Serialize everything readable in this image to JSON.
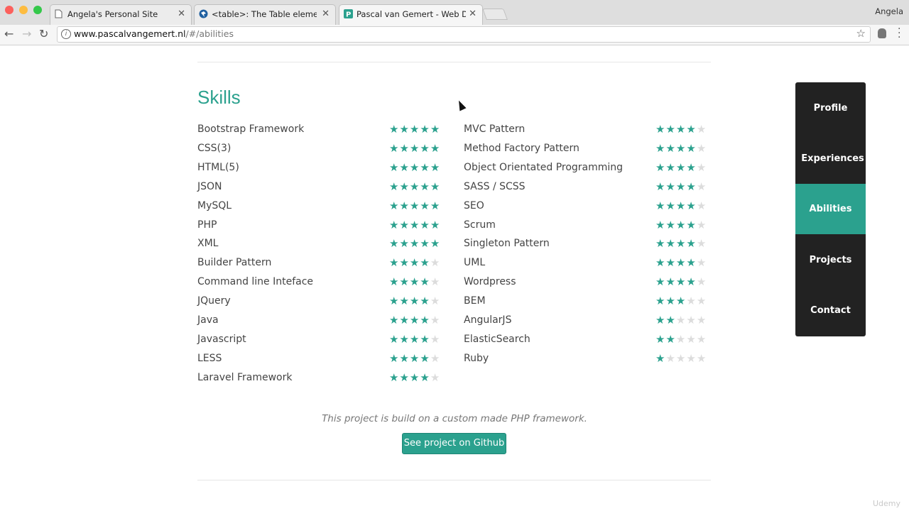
{
  "browser": {
    "tabs": [
      {
        "label": "Angela's Personal Site",
        "active": false
      },
      {
        "label": "<table>: The Table element - H",
        "active": false
      },
      {
        "label": "Pascal van Gemert - Web Deve",
        "active": true
      }
    ],
    "user": "Angela",
    "url_domain": "www.pascalvangemert.nl",
    "url_path": "/#/abilities"
  },
  "page": {
    "heading": "Skills",
    "skills_left": [
      {
        "name": "Bootstrap Framework",
        "rating": 5
      },
      {
        "name": "CSS(3)",
        "rating": 5
      },
      {
        "name": "HTML(5)",
        "rating": 5
      },
      {
        "name": "JSON",
        "rating": 5
      },
      {
        "name": "MySQL",
        "rating": 5
      },
      {
        "name": "PHP",
        "rating": 5
      },
      {
        "name": "XML",
        "rating": 5
      },
      {
        "name": "Builder Pattern",
        "rating": 4
      },
      {
        "name": "Command line Inteface",
        "rating": 4
      },
      {
        "name": "JQuery",
        "rating": 4
      },
      {
        "name": "Java",
        "rating": 4
      },
      {
        "name": "Javascript",
        "rating": 4
      },
      {
        "name": "LESS",
        "rating": 4
      },
      {
        "name": "Laravel Framework",
        "rating": 4
      }
    ],
    "skills_right": [
      {
        "name": "MVC Pattern",
        "rating": 4
      },
      {
        "name": "Method Factory Pattern",
        "rating": 4
      },
      {
        "name": "Object Orientated Programming",
        "rating": 4
      },
      {
        "name": "SASS / SCSS",
        "rating": 4
      },
      {
        "name": "SEO",
        "rating": 4
      },
      {
        "name": "Scrum",
        "rating": 4
      },
      {
        "name": "Singleton Pattern",
        "rating": 4
      },
      {
        "name": "UML",
        "rating": 4
      },
      {
        "name": "Wordpress",
        "rating": 4
      },
      {
        "name": "BEM",
        "rating": 3
      },
      {
        "name": "AngularJS",
        "rating": 2
      },
      {
        "name": "ElasticSearch",
        "rating": 2
      },
      {
        "name": "Ruby",
        "rating": 1
      }
    ],
    "project_note": "This project is build on a custom made PHP framework.",
    "github_button": "See project on Github",
    "accent_color": "#2ba18e"
  },
  "sidenav": {
    "items": [
      "Profile",
      "Experiences",
      "Abilities",
      "Projects",
      "Contact"
    ],
    "active": "Abilities"
  },
  "watermark": "Udemy"
}
